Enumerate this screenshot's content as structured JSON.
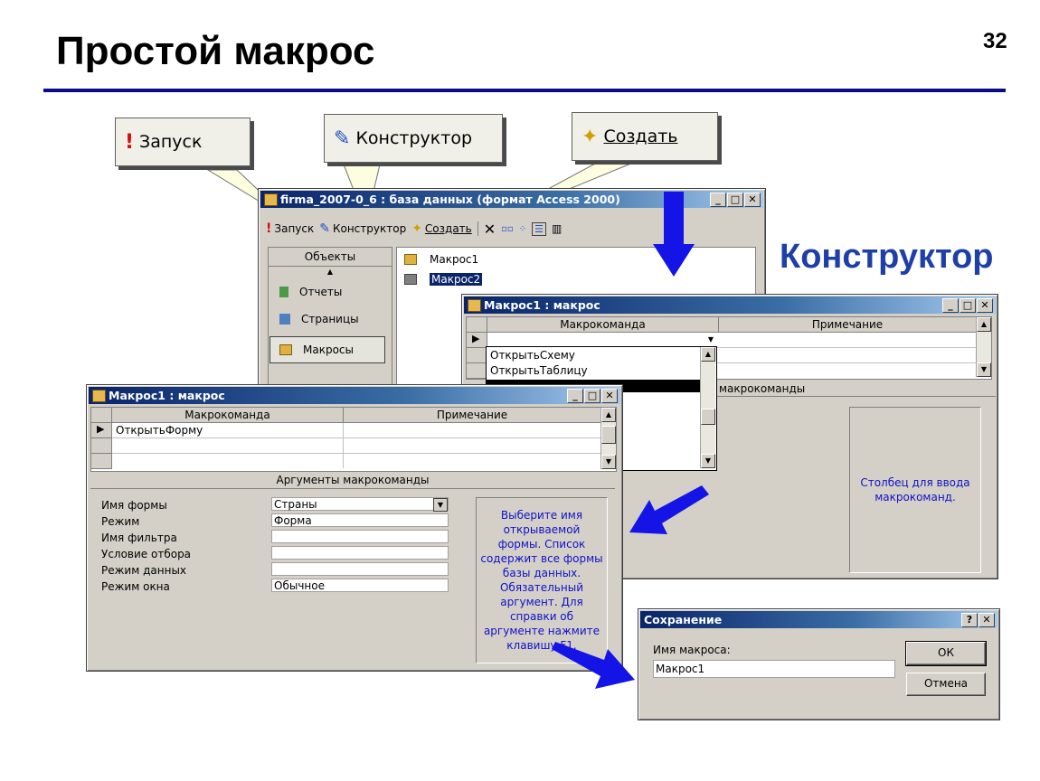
{
  "slide": {
    "title": "Простой макрос",
    "page": "32",
    "label": "Конструктор"
  },
  "callouts": {
    "run": "Запуск",
    "design": "Конструктор",
    "create": "Создать"
  },
  "db_window": {
    "title": "firma_2007-0_6 : база данных (формат Access 2000)",
    "toolbar": {
      "run": "Запуск",
      "design": "Конструктор",
      "create": "Создать"
    },
    "objects_header": "Объекты",
    "objects": [
      "Отчеты",
      "Страницы",
      "Макросы"
    ],
    "macros": [
      "Макрос1",
      "Макрос2"
    ]
  },
  "macro_back": {
    "title": "Макрос1 : макрос",
    "col_action": "Макрокоманда",
    "col_note": "Примечание",
    "dropdown_items": [
      "ОткрытьСхему",
      "ОткрытьТаблицу"
    ],
    "args_header": "макрокоманды",
    "hint": "Столбец для ввода макрокоманд."
  },
  "macro_front": {
    "title": "Макрос1 : макрос",
    "col_action": "Макрокоманда",
    "col_note": "Примечание",
    "row1_action": "ОткрытьФорму",
    "args_header": "Аргументы макрокоманды",
    "args": [
      {
        "label": "Имя формы",
        "value": "Страны"
      },
      {
        "label": "Режим",
        "value": "Форма"
      },
      {
        "label": "Имя фильтра",
        "value": ""
      },
      {
        "label": "Условие отбора",
        "value": ""
      },
      {
        "label": "Режим данных",
        "value": ""
      },
      {
        "label": "Режим окна",
        "value": "Обычное"
      }
    ],
    "hint": "Выберите имя открываемой формы. Список содержит все формы базы данных. Обязательный аргумент. Для справки об аргументе нажмите клавишу F1."
  },
  "save_dialog": {
    "title": "Сохранение",
    "label": "Имя макроса:",
    "value": "Макрос1",
    "ok": "ОК",
    "cancel": "Отмена"
  },
  "colors": {
    "accent": "#1f3fa8",
    "arrow": "#1414e6",
    "titlebar": "#0a246a"
  }
}
